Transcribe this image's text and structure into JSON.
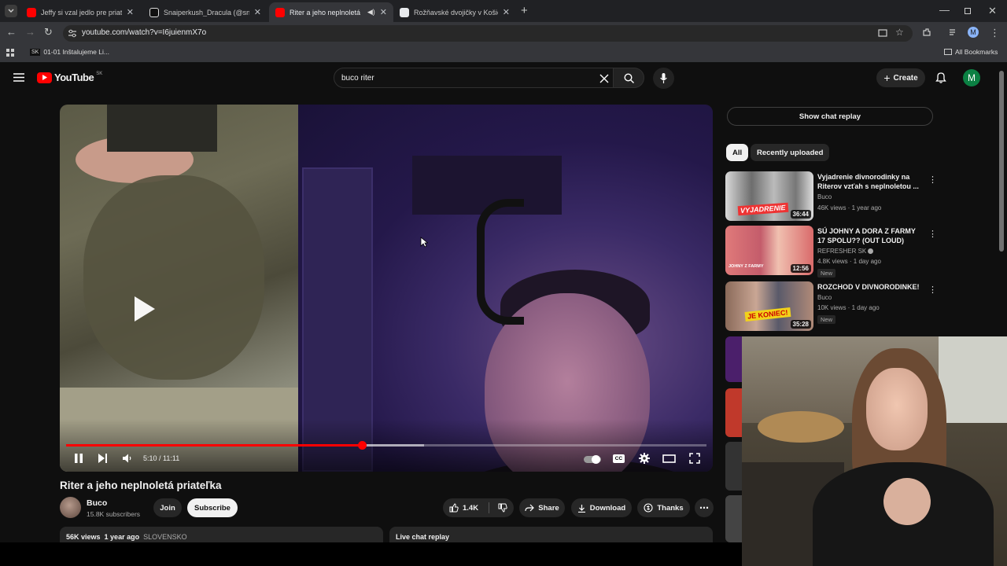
{
  "browser": {
    "tabs": [
      {
        "label": "Jeffy si vzal jedlo pre priateľku d",
        "active": false,
        "favicon_color": "#ff0000"
      },
      {
        "label": "Snaiperkush_Dracula (@snaiper",
        "active": false,
        "favicon_color": "#ffffff"
      },
      {
        "label": "Riter a jeho neplnoletá priat",
        "active": true,
        "favicon_color": "#ff0000"
      },
      {
        "label": "Rožňavské dvojičky v Košiciach",
        "active": false,
        "favicon_color": "#4285f4"
      }
    ],
    "url": "youtube.com/watch?v=I6juienmX7o",
    "bookmark": "01-01 Inštalujeme Li...",
    "bookmark_badge": "SK",
    "all_bookmarks": "All Bookmarks",
    "profile_initial": "M"
  },
  "youtube": {
    "logo_text": "YouTube",
    "region": "SK",
    "search_value": "buco riter",
    "create_label": "Create",
    "avatar_initial": "M"
  },
  "player": {
    "time": "5:10 / 11:11",
    "progress": 0.463,
    "buffered": 0.559
  },
  "video": {
    "title": "Riter a jeho neplnoletá priateľka",
    "channel": "Buco",
    "subscribers": "15.8K subscribers",
    "join_label": "Join",
    "subscribe_label": "Subscribe",
    "likes": "1.4K",
    "share_label": "Share",
    "download_label": "Download",
    "thanks_label": "Thanks",
    "views": "56K views",
    "age": "1 year ago",
    "tag": "SLOVENSKO",
    "live_chat": "Live chat replay"
  },
  "sidebar": {
    "chat_button": "Show chat replay",
    "chips": [
      "All",
      "Recently uploaded"
    ],
    "recommendations": [
      {
        "title": "Vyjadrenie divnorodinky na Riterov vzťah s neplnoletou ...",
        "channel": "Buco",
        "meta": "46K views · 1 year ago",
        "duration": "36:44",
        "thumb_text": "VYJADRENIE",
        "new": false
      },
      {
        "title": "SÚ JOHNY A DORA Z FARMY 17 SPOLU?? (OUT LOUD)",
        "channel": "REFRESHER SK",
        "meta": "4.8K views · 1 day ago",
        "duration": "12:56",
        "thumb_text": "JOHNY Z FARMY",
        "new": true
      },
      {
        "title": "ROZCHOD V DIVNORODINKE!",
        "channel": "Buco",
        "meta": "10K views · 1 day ago",
        "duration": "35:28",
        "thumb_text": "JE KONIEC!",
        "new": true
      }
    ],
    "new_badge": "New"
  }
}
